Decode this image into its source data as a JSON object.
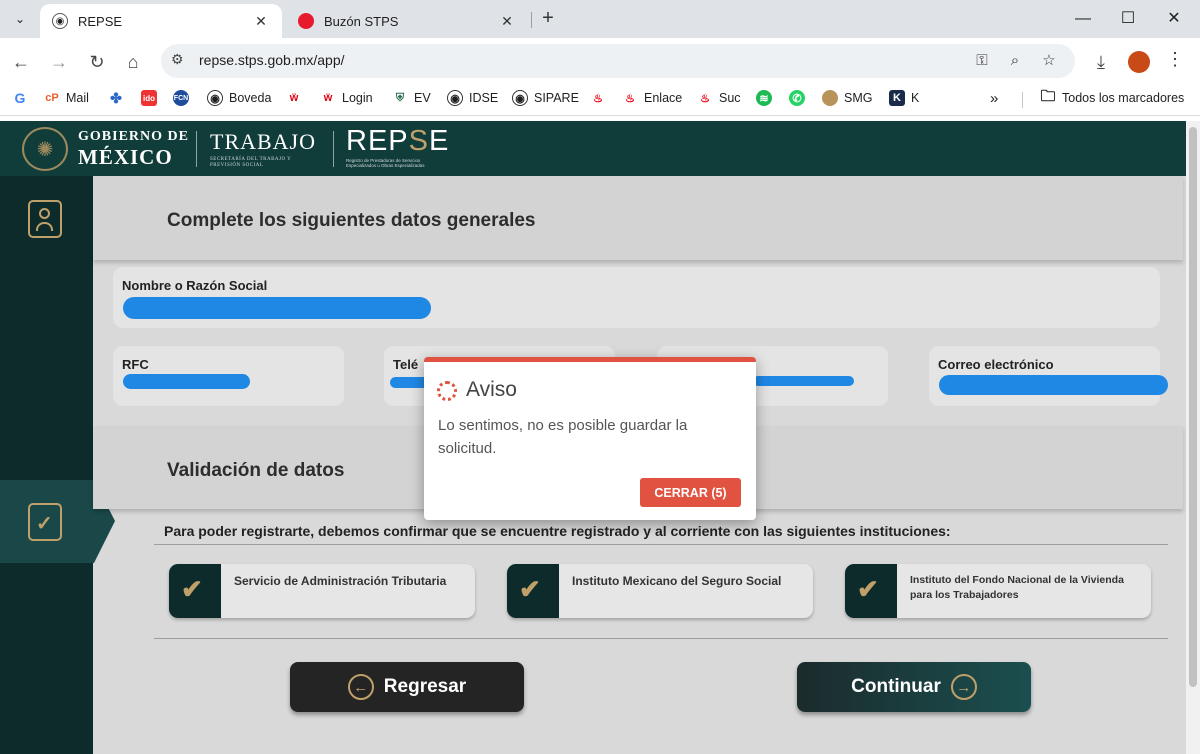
{
  "browser": {
    "tabs": [
      {
        "title": "REPSE",
        "active": true
      },
      {
        "title": "Buzón STPS",
        "active": false
      }
    ],
    "url": "repse.stps.gob.mx/app/",
    "bookmarks": [
      "Mail",
      "Boveda",
      "Login",
      "EV",
      "IDSE",
      "SIPARE",
      "Enlace",
      "Suc",
      "SMG",
      "K"
    ],
    "all_bookmarks": "Todos los marcadores"
  },
  "header": {
    "gob_line1": "GOBIERNO DE",
    "gob_line2": "MÉXICO",
    "trabajo": "TRABAJO",
    "trabajo_sub": "SECRETARÍA DEL TRABAJO Y PREVISIÓN SOCIAL",
    "repse_a": "REP",
    "repse_b": "S",
    "repse_c": "E",
    "repse_sub": "Registro de Prestadoras de Servicios Especializados u Obras Especializadas"
  },
  "form": {
    "title": "Complete los siguientes datos generales",
    "fields": {
      "name_label": "Nombre o Razón Social",
      "rfc_label": "RFC",
      "phone_label": "Telé",
      "email_label": "Correo electrónico"
    }
  },
  "validation": {
    "title": "Validación de datos",
    "info": "Para poder registrarte, debemos confirmar que se encuentre registrado y al corriente con las siguientes instituciones:",
    "institutions": [
      {
        "label": "Servicio de Administración Tributaria",
        "status": "checked"
      },
      {
        "label": "Instituto Mexicano del Seguro Social",
        "status": "checked"
      },
      {
        "label": "Instituto del Fondo Nacional de la Vivienda para los Trabajadores",
        "status": "checked"
      }
    ]
  },
  "buttons": {
    "back": "Regresar",
    "next": "Continuar"
  },
  "modal": {
    "title": "Aviso",
    "message": "Lo sentimos, no es posible guardar la solicitud.",
    "close": "CERRAR (5)"
  },
  "colors": {
    "header_bg": "#103c3a",
    "gold": "#bfa06a",
    "alert_red": "#e15241",
    "redaction_blue": "#1f88e5"
  }
}
